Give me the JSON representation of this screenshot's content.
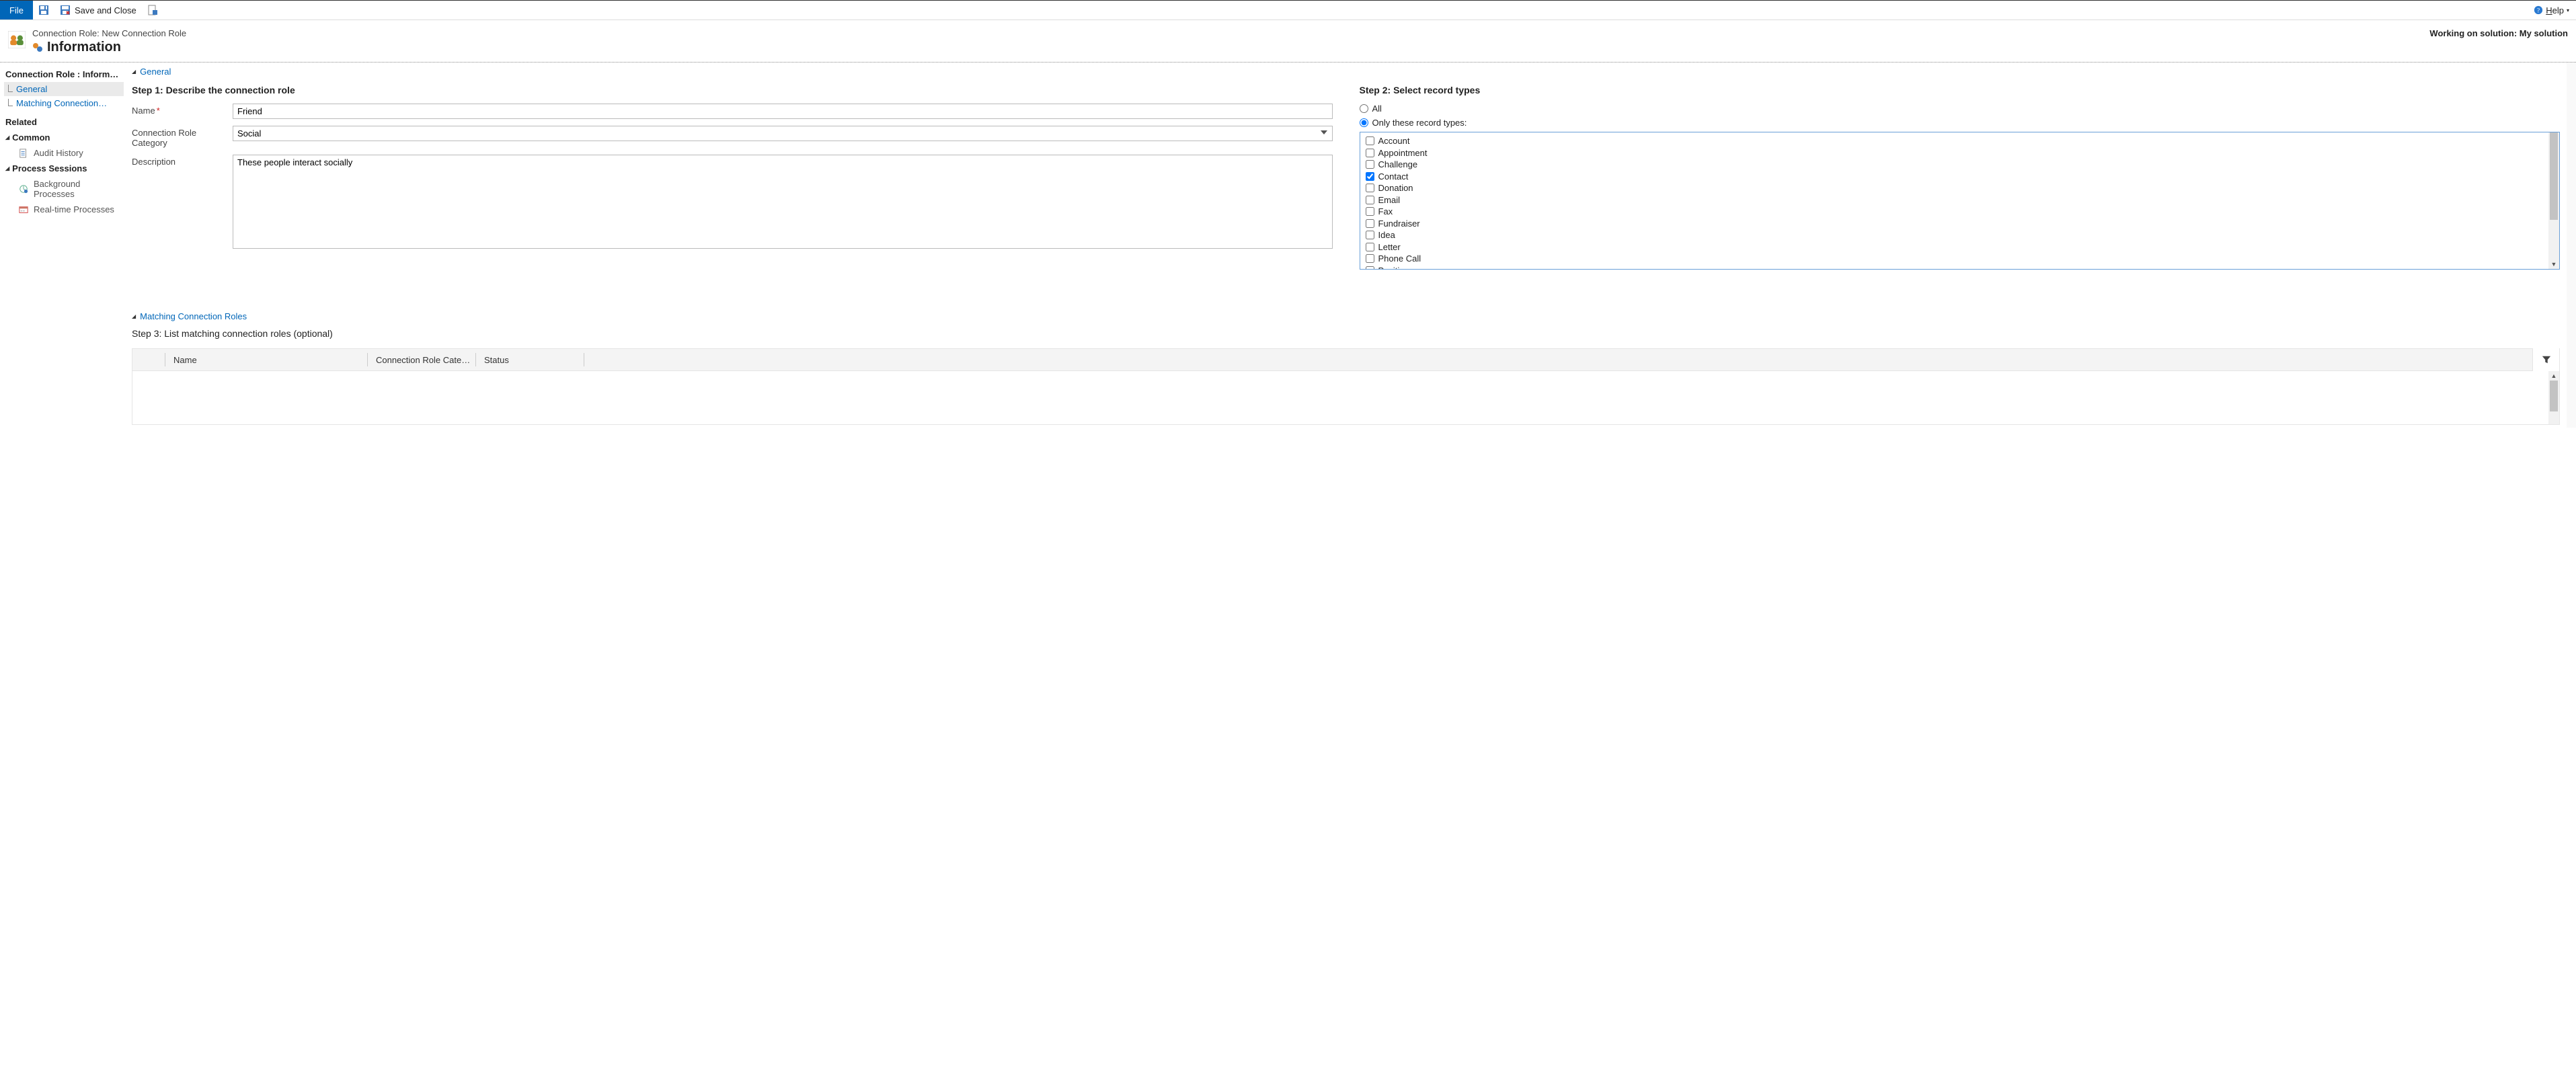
{
  "toolbar": {
    "file_label": "File",
    "save_close_label": "Save and Close"
  },
  "help": {
    "label": "Help"
  },
  "header": {
    "breadcrumb": "Connection Role: New Connection Role",
    "title": "Information",
    "solution_text": "Working on solution: My solution"
  },
  "nav": {
    "root": "Connection Role : Inform…",
    "items": [
      {
        "label": "General",
        "active": true
      },
      {
        "label": "Matching Connection…",
        "active": false
      }
    ],
    "related_label": "Related",
    "groups": [
      {
        "label": "Common",
        "links": [
          {
            "label": "Audit History"
          }
        ]
      },
      {
        "label": "Process Sessions",
        "links": [
          {
            "label": "Background Processes"
          },
          {
            "label": "Real-time Processes"
          }
        ]
      }
    ]
  },
  "section_general": {
    "title": "General",
    "step1_title": "Step 1: Describe the connection role",
    "name_label": "Name",
    "name_value": "Friend",
    "category_label": "Connection Role Category",
    "category_value": "Social",
    "description_label": "Description",
    "description_value": "These people interact socially",
    "step2_title": "Step 2: Select record types",
    "radio_all_label": "All",
    "radio_only_label": "Only these record types:",
    "radio_selected": "only",
    "record_types": [
      {
        "label": "Account",
        "checked": false
      },
      {
        "label": "Appointment",
        "checked": false
      },
      {
        "label": "Challenge",
        "checked": false
      },
      {
        "label": "Contact",
        "checked": true
      },
      {
        "label": "Donation",
        "checked": false
      },
      {
        "label": "Email",
        "checked": false
      },
      {
        "label": "Fax",
        "checked": false
      },
      {
        "label": "Fundraiser",
        "checked": false
      },
      {
        "label": "Idea",
        "checked": false
      },
      {
        "label": "Letter",
        "checked": false
      },
      {
        "label": "Phone Call",
        "checked": false
      },
      {
        "label": "Position",
        "checked": false
      }
    ]
  },
  "section_matching": {
    "title": "Matching Connection Roles",
    "step3_title": "Step 3: List matching connection roles (optional)",
    "columns": {
      "name": "Name",
      "category": "Connection Role Cate…",
      "status": "Status"
    }
  }
}
